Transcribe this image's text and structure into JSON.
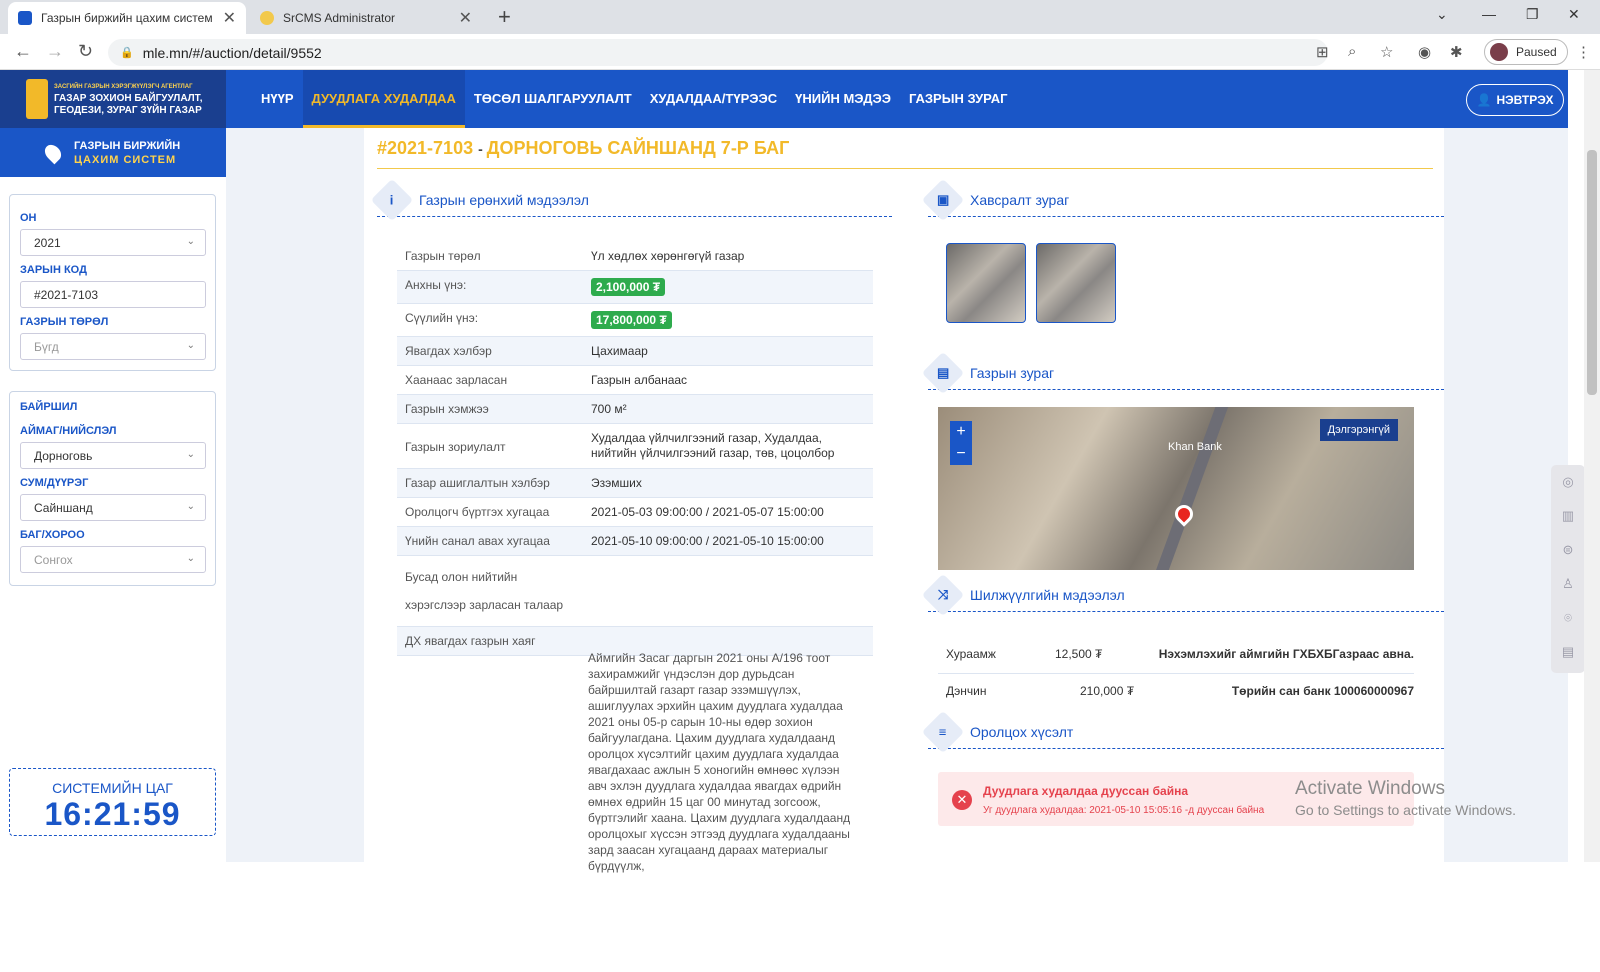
{
  "browser": {
    "tabs": [
      {
        "title": "Газрын биржийн цахим систем",
        "active": true
      },
      {
        "title": "SrCMS Administrator",
        "active": false
      }
    ],
    "url": "mle.mn/#/auction/detail/9552",
    "profile_label": "Paused"
  },
  "header": {
    "logo_small": "ЗАСГИЙН ГАЗРЫН ХЭРЭГЖҮҮЛЭГЧ АГЕНТЛАГ",
    "logo_line1": "ГАЗАР ЗОХИОН БАЙГУУЛАЛТ,",
    "logo_line2": "ГЕОДЕЗИ, ЗУРАГ ЗҮЙН ГАЗАР",
    "menu": [
      "НҮҮР",
      "ДУУДЛАГА ХУДАЛДАА",
      "ТӨСӨЛ ШАЛГАРУУЛАЛТ",
      "ХУДАЛДАА/ТҮРЭЭС",
      "ҮНИЙН МЭДЭЭ",
      "ГАЗРЫН ЗУРАГ"
    ],
    "active_menu": "ДУУДЛАГА ХУДАЛДАА",
    "login_label": "НЭВТРЭХ"
  },
  "sidebar": {
    "brand_line1": "ГАЗРЫН БИРЖИЙН",
    "brand_line2": "ЦАХИМ СИСТЕМ",
    "filters": {
      "year_label": "ОН",
      "year_value": "2021",
      "code_label": "ЗАРЫН КОД",
      "code_value": "#2021-7103",
      "type_label": "ГАЗРЫН ТӨРӨЛ",
      "type_value": "Бүгд"
    },
    "location": {
      "title": "БАЙРШИЛ",
      "aimag_label": "АЙМАГ/НИЙСЛЭЛ",
      "aimag_value": "Дорноговь",
      "sum_label": "СУМ/ДҮҮРЭГ",
      "sum_value": "Сайншанд",
      "bag_label": "БАГ/ХОРОО",
      "bag_value": "Сонгох"
    },
    "clock_label": "СИСТЕМИЙН ЦАГ",
    "clock_time": "16:21:59"
  },
  "detail": {
    "code": "#2021-7103",
    "title": "ДОРНОГОВЬ САЙНШАНД 7-Р БАГ",
    "general_title": "Газрын ерөнхий мэдээлэл",
    "rows": [
      {
        "k": "Газрын төрөл",
        "v": "Үл хөдлөх хөрөнгөгүй газар"
      },
      {
        "k": "Анхны үнэ:",
        "v": "2,100,000 ₮"
      },
      {
        "k": "Сүүлийн үнэ:",
        "v": "17,800,000 ₮"
      },
      {
        "k": "Явагдах хэлбэр",
        "v": "Цахимаар"
      },
      {
        "k": "Хаанаас зарласан",
        "v": "Газрын албанаас"
      },
      {
        "k": "Газрын хэмжээ",
        "v": "700 м²"
      },
      {
        "k": "Газрын зориулалт",
        "v": "Худалдаа үйлчилгээний газар, Худалдаа, нийтийн үйлчилгээний газар, төв, цоцолбор"
      },
      {
        "k": "Газар ашиглалтын хэлбэр",
        "v": "Эзэмших"
      },
      {
        "k": "Оролцогч бүртгэх хугацаа",
        "v": "2021-05-03 09:00:00 / 2021-05-07 15:00:00"
      },
      {
        "k": "Үнийн санал авах хугацаа",
        "v": "2021-05-10 09:00:00 / 2021-05-10 15:00:00"
      },
      {
        "k": "Бусад олон нийтийн хэрэгслээр зарласан талаар",
        "v": ""
      },
      {
        "k": "ДХ явагдах газрын хаяг",
        "v": ""
      }
    ],
    "description": "Аймгийн Засаг даргын 2021 оны А/196 тоот захирамжийг үндэслэн дор дурьдсан байршилтай газарт газар эзэмшүүлэх, ашиглуулах эрхийн цахим дуудлага худалдаа 2021 оны 05-р сарын 10-ны өдөр зохион байгуулагдана. Цахим дуудлага худалдаанд оролцох хүсэлтийг цахим дуудлага худалдаа явагдахаас ажлын 5 хоногийн өмнөөс хүлээн авч эхлэн дуудлага худалдаа явагдах өдрийн өмнөх өдрийн 15 цаг 00 минутад зогсоож, бүртгэлийг хаана. Цахим дуудлага худалдаанд оролцохыг хүссэн этгээд дуудлага худалдааны зард заасан хугацаанд дараах материалыг бүрдүүлж,",
    "attach_title": "Хавсралт зураг",
    "map_title": "Газрын зураг",
    "map_more": "Дэлгэрэнгүй",
    "map_label": "Khan Bank",
    "transfer_title": "Шилжүүлгийн мэдээлэл",
    "fees": [
      {
        "name": "Хураамж",
        "amount": "12,500 ₮",
        "note": "Нэхэмлэхийг аймгийн ГХБХБГазраас авна."
      },
      {
        "name": "Дэнчин",
        "amount": "210,000 ₮",
        "note": "Төрийн сан банк 100060000967"
      }
    ],
    "apply_title": "Оролцох хүсэлт",
    "alert_title": "Дуудлага худалдаа дууссан байна",
    "alert_text": "Уг дуудлага худалдаа: 2021-05-10 15:05:16 -д дууссан байна"
  },
  "watermark": {
    "line1": "Activate Windows",
    "line2": "Go to Settings to activate Windows."
  }
}
